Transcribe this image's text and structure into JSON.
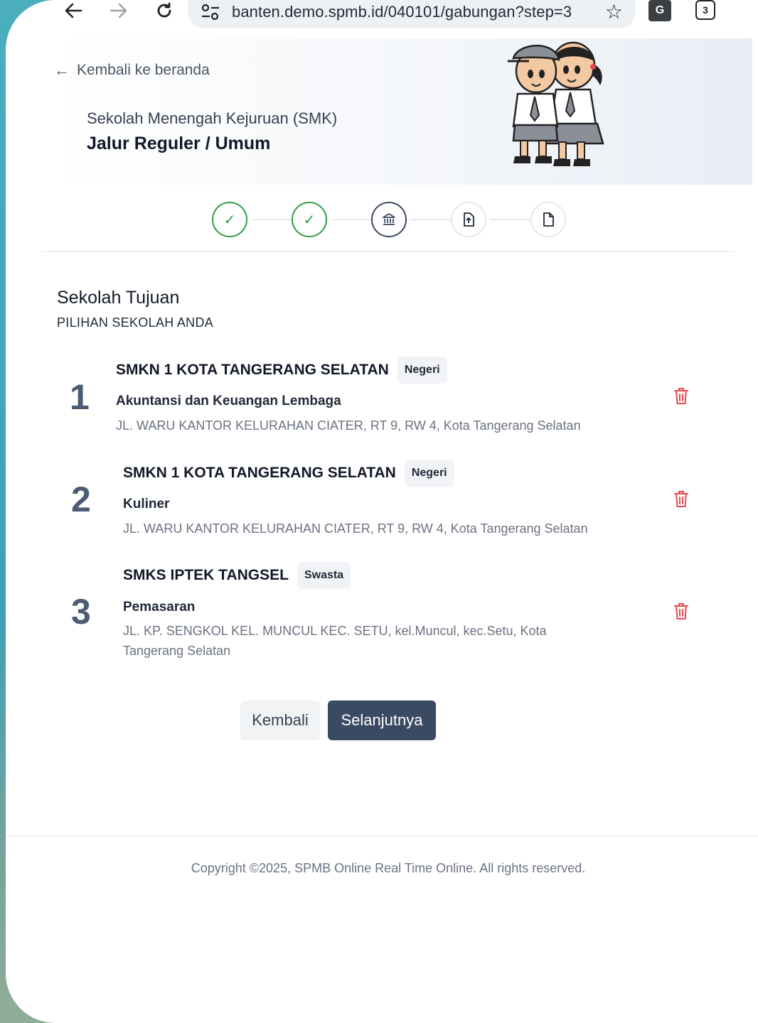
{
  "browser": {
    "url": "banten.demo.spmb.id/040101/gabungan?step=3",
    "tab_count": "3",
    "translate_label": "G"
  },
  "hero": {
    "back_link": "Kembali ke beranda",
    "subtitle": "Sekolah Menengah Kejuruan (SMK)",
    "title": "Jalur Reguler / Umum"
  },
  "stepper": {
    "current_step": 3,
    "steps": [
      {
        "status": "done",
        "icon": "check-icon"
      },
      {
        "status": "done",
        "icon": "check-icon"
      },
      {
        "status": "active",
        "icon": "bank-icon"
      },
      {
        "status": "todo",
        "icon": "file-upload-icon"
      },
      {
        "status": "todo",
        "icon": "file-icon"
      }
    ]
  },
  "section": {
    "title": "Sekolah Tujuan",
    "subtitle": "PILIHAN SEKOLAH ANDA"
  },
  "choices": [
    {
      "number": "1",
      "school": "SMKN 1 KOTA TANGERANG SELATAN",
      "type": "Negeri",
      "major": "Akuntansi dan Keuangan Lembaga",
      "address": "JL. WARU KANTOR KELURAHAN CIATER, RT 9, RW 4, Kota Tangerang Selatan"
    },
    {
      "number": "2",
      "school": "SMKN 1 KOTA TANGERANG SELATAN",
      "type": "Negeri",
      "major": "Kuliner",
      "address": "JL. WARU KANTOR KELURAHAN CIATER, RT 9, RW 4, Kota Tangerang Selatan"
    },
    {
      "number": "3",
      "school": "SMKS IPTEK TANGSEL",
      "type": "Swasta",
      "major": "Pemasaran",
      "address": "JL. KP. SENGKOL KEL. MUNCUL KEC. SETU, kel.Muncul, kec.Setu, Kota Tangerang Selatan"
    }
  ],
  "actions": {
    "back_label": "Kembali",
    "next_label": "Selanjutnya"
  },
  "footer": {
    "copyright": "Copyright ©2025, SPMB Online Real Time Online. All rights reserved."
  },
  "colors": {
    "primary": "#3b4a63",
    "success": "#2f9e44",
    "danger": "#e5484d"
  }
}
